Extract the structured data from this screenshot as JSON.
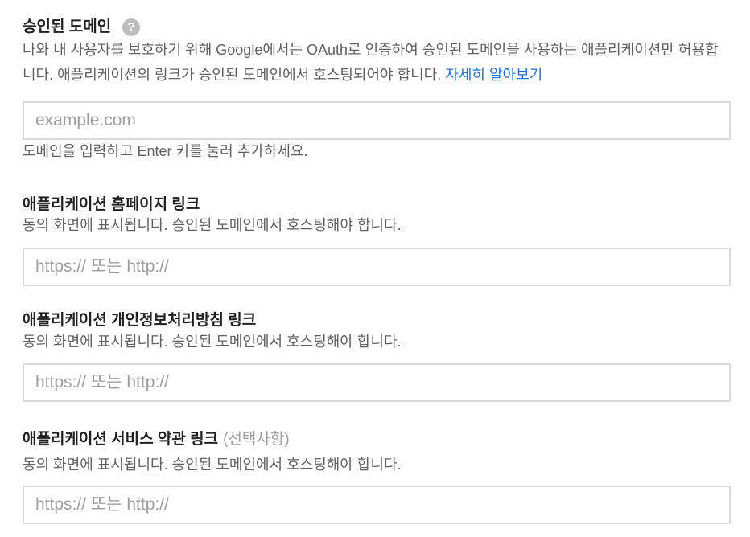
{
  "authorized_domains": {
    "title": "승인된 도메인",
    "help_icon_label": "?",
    "description": "나와 내 사용자를 보호하기 위해 Google에서는 OAuth로 인증하여 승인된 도메인을 사용하는 애플리케이션만 허용합니다. 애플리케이션의 링크가 승인된 도메인에서 호스팅되어야 합니다.",
    "learn_more_link": "자세히 알아보기",
    "input_placeholder": "example.com",
    "input_hint": "도메인을 입력하고 Enter 키를 눌러 추가하세요."
  },
  "homepage_link": {
    "title": "애플리케이션 홈페이지 링크",
    "description": "동의 화면에 표시됩니다. 승인된 도메인에서 호스팅해야 합니다.",
    "input_placeholder": "https:// 또는 http://"
  },
  "privacy_policy_link": {
    "title": "애플리케이션 개인정보처리방침 링크",
    "description": "동의 화면에 표시됩니다. 승인된 도메인에서 호스팅해야 합니다.",
    "input_placeholder": "https:// 또는 http://"
  },
  "terms_of_service_link": {
    "title": "애플리케이션 서비스 약관 링크",
    "optional_label": "(선택사항)",
    "description": "동의 화면에 표시됩니다. 승인된 도메인에서 호스팅해야 합니다.",
    "input_placeholder": "https:// 또는 http://"
  },
  "colors": {
    "link": "#1a73e8",
    "muted_text": "#616161",
    "placeholder": "#9e9e9e",
    "input_border": "#dadada"
  }
}
